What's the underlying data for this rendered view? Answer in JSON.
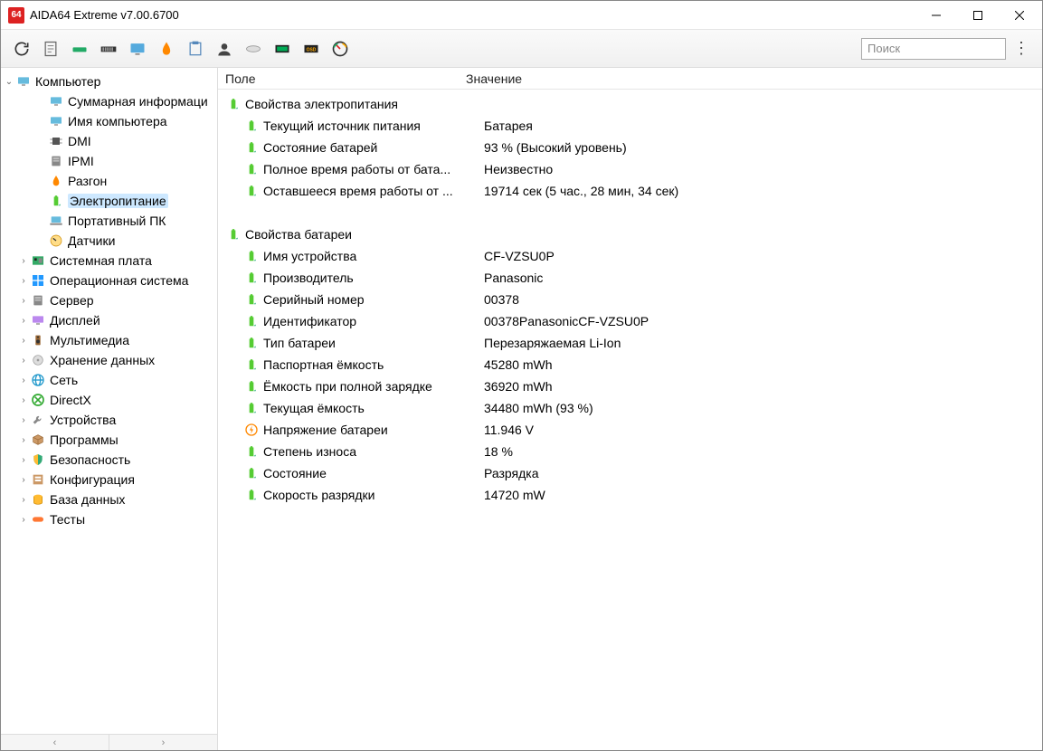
{
  "window": {
    "title": "AIDA64 Extreme v7.00.6700"
  },
  "toolbar": {
    "search_placeholder": "Поиск"
  },
  "columns": {
    "field": "Поле",
    "value": "Значение"
  },
  "tree": {
    "root": "Компьютер",
    "root_children": [
      "Суммарная информаци",
      "Имя компьютера",
      "DMI",
      "IPMI",
      "Разгон",
      "Электропитание",
      "Портативный ПК",
      "Датчики"
    ],
    "siblings": [
      "Системная плата",
      "Операционная система",
      "Сервер",
      "Дисплей",
      "Мультимедиа",
      "Хранение данных",
      "Сеть",
      "DirectX",
      "Устройства",
      "Программы",
      "Безопасность",
      "Конфигурация",
      "База данных",
      "Тесты"
    ],
    "selected": "Электропитание"
  },
  "sections": [
    {
      "title": "Свойства электропитания",
      "rows": [
        {
          "field": "Текущий источник питания",
          "value": "Батарея",
          "icon": "batt"
        },
        {
          "field": "Состояние батарей",
          "value": "93 % (Высокий уровень)",
          "icon": "batt"
        },
        {
          "field": "Полное время работы от бата...",
          "value": "Неизвестно",
          "icon": "batt"
        },
        {
          "field": "Оставшееся время работы от ...",
          "value": "19714 сек (5 час., 28 мин, 34 сек)",
          "icon": "batt"
        }
      ]
    },
    {
      "title": "Свойства батареи",
      "rows": [
        {
          "field": "Имя устройства",
          "value": "CF-VZSU0P",
          "icon": "batt"
        },
        {
          "field": "Производитель",
          "value": "Panasonic",
          "icon": "batt"
        },
        {
          "field": "Серийный номер",
          "value": "00378",
          "icon": "batt"
        },
        {
          "field": "Идентификатор",
          "value": "00378PanasonicCF-VZSU0P",
          "icon": "batt"
        },
        {
          "field": "Тип батареи",
          "value": "Перезаряжаемая Li-Ion",
          "icon": "batt"
        },
        {
          "field": "Паспортная ёмкость",
          "value": "45280 mWh",
          "icon": "batt"
        },
        {
          "field": "Ёмкость при полной зарядке",
          "value": "36920 mWh",
          "icon": "batt"
        },
        {
          "field": "Текущая ёмкость",
          "value": "34480 mWh  (93 %)",
          "icon": "batt"
        },
        {
          "field": "Напряжение батареи",
          "value": "11.946 V",
          "icon": "volt"
        },
        {
          "field": "Степень износа",
          "value": "18 %",
          "icon": "batt"
        },
        {
          "field": "Состояние",
          "value": "Разрядка",
          "icon": "batt"
        },
        {
          "field": "Скорость разрядки",
          "value": "14720 mW",
          "icon": "batt"
        }
      ]
    }
  ]
}
